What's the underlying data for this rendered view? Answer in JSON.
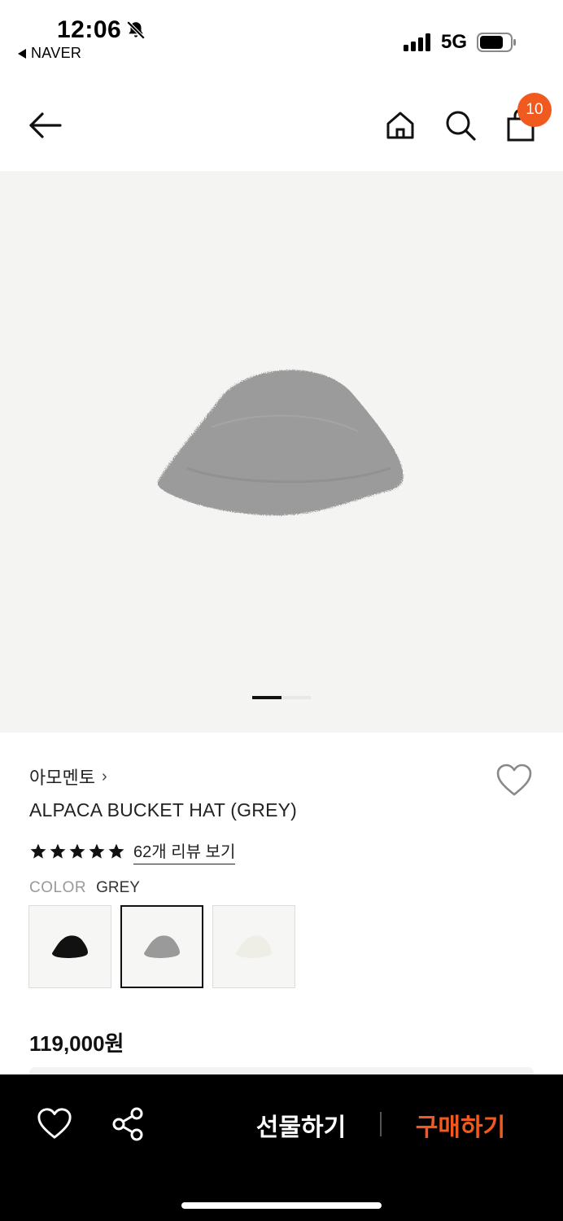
{
  "status_bar": {
    "time": "12:06",
    "back_app": "NAVER",
    "network": "5G"
  },
  "header": {
    "cart_count": "10"
  },
  "product": {
    "brand": "아모멘토",
    "brand_chevron": "›",
    "name": "ALPACA BUCKET HAT (GREY)",
    "rating_stars": 5,
    "review_link": "62개 리뷰 보기",
    "color_label": "COLOR",
    "color_value": "GREY",
    "swatches": [
      {
        "color": "#111111",
        "selected": false
      },
      {
        "color": "#9a9a9a",
        "selected": true
      },
      {
        "color": "#efeee6",
        "selected": false
      }
    ],
    "price": "119,000원",
    "image_bg": "#f4f4f2",
    "hat_color": "#9b9b9b"
  },
  "bottom_bar": {
    "gift_label": "선물하기",
    "buy_label": "구매하기",
    "accent": "#f15a1f"
  },
  "icons": [
    "bell-off-icon",
    "back-arrow-icon",
    "home-icon",
    "search-icon",
    "cart-icon",
    "heart-icon",
    "share-icon",
    "star-icon"
  ]
}
